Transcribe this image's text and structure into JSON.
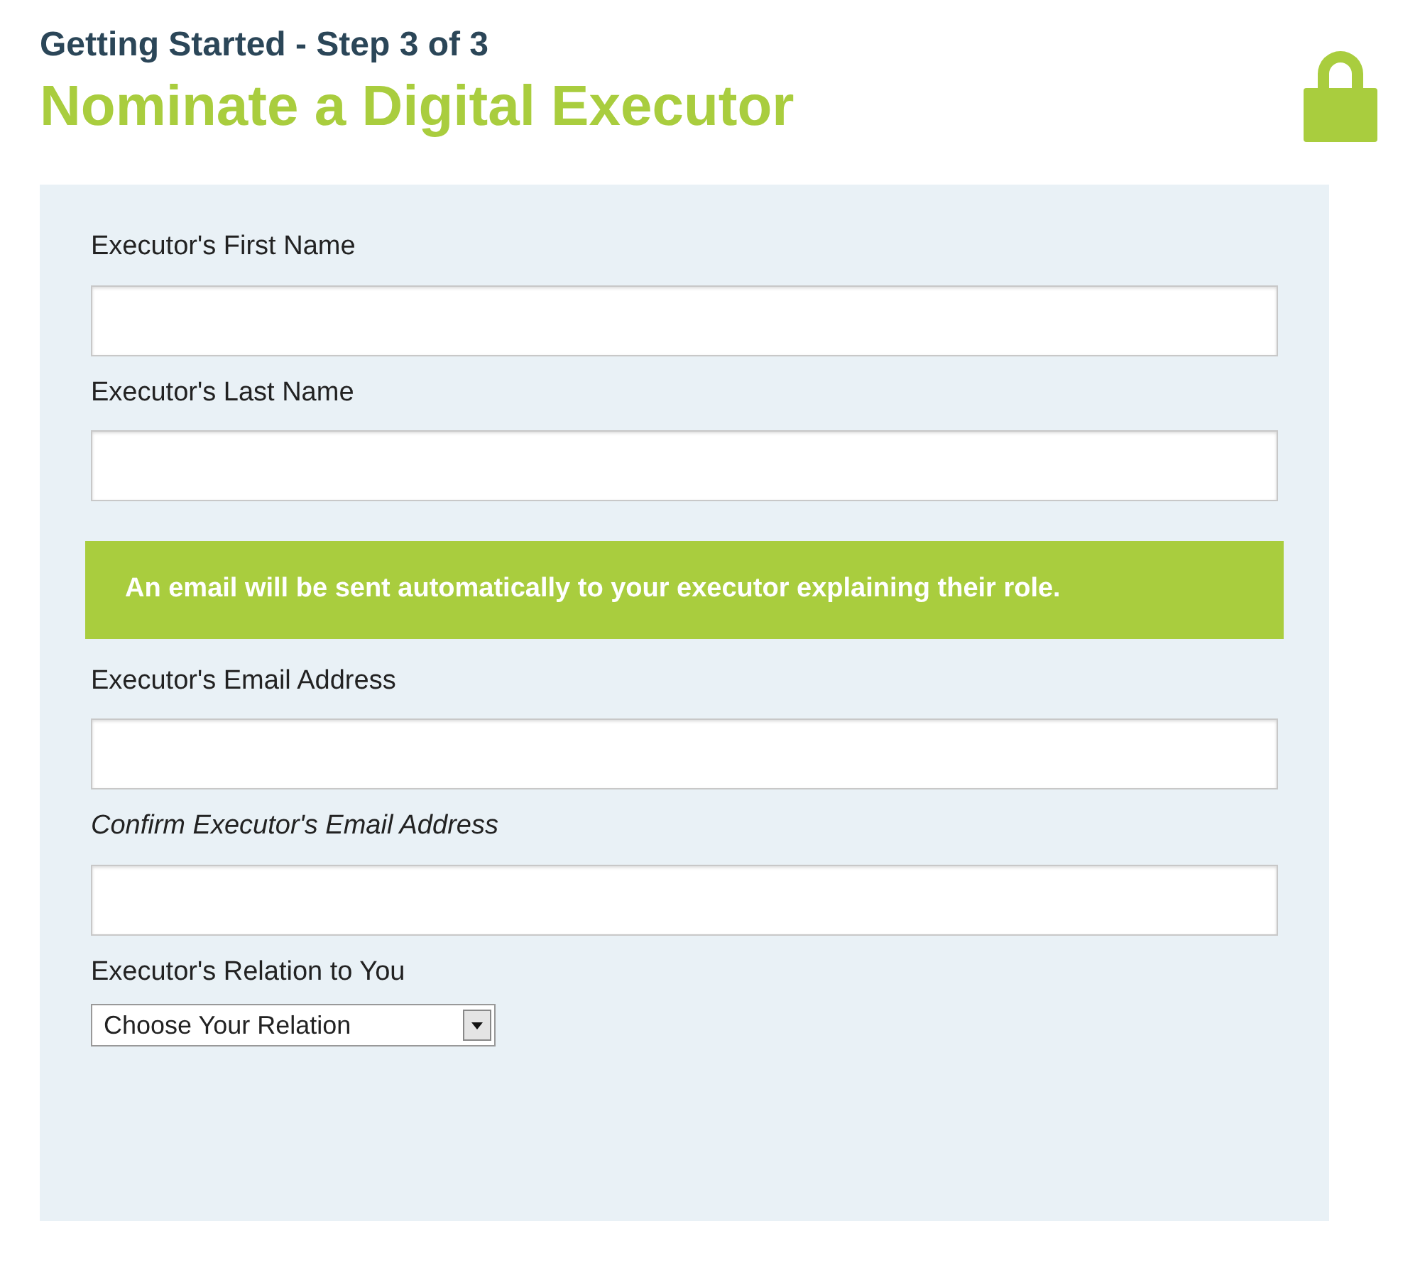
{
  "header": {
    "step": "Getting Started - Step 3 of 3",
    "title": "Nominate a Digital Executor"
  },
  "form": {
    "fields": [
      {
        "kind": "text",
        "label": "Executor's First Name",
        "italic": false
      },
      {
        "kind": "text",
        "label": "Executor's Last Name",
        "italic": false
      },
      {
        "kind": "notice",
        "text": "An email will be sent automatically to your executor explaining their role."
      },
      {
        "kind": "text",
        "label": "Executor's Email Address",
        "italic": false
      },
      {
        "kind": "text",
        "label": "Confirm Executor's Email Address",
        "italic": true
      },
      {
        "kind": "select",
        "label": "Executor's Relation to You",
        "italic": false,
        "value": "Choose Your Relation"
      }
    ]
  }
}
